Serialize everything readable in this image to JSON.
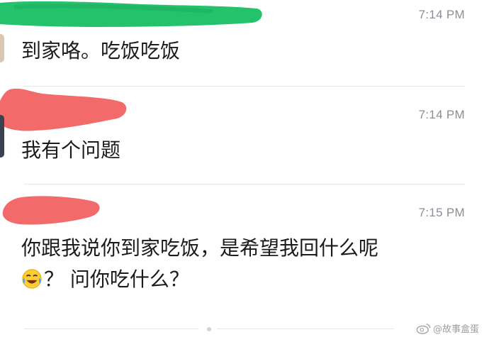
{
  "messages": [
    {
      "time": "7:14 PM",
      "text": "到家咯。吃饭吃饭",
      "sender_redaction_color": "#23c26b"
    },
    {
      "time": "7:14 PM",
      "text": "我有个问题",
      "sender_redaction_color": "#f26a6a"
    },
    {
      "time": "7:15 PM",
      "line1": "你跟我说你到家吃饭，是希望我回什么呢",
      "line2": "？ 问你吃什么？",
      "emoji": "tears-of-joy-emoji",
      "sender_redaction_color": "#f26a6a"
    }
  ],
  "watermark": {
    "text": "@故事盒蛋",
    "icon": "weibo-icon"
  }
}
